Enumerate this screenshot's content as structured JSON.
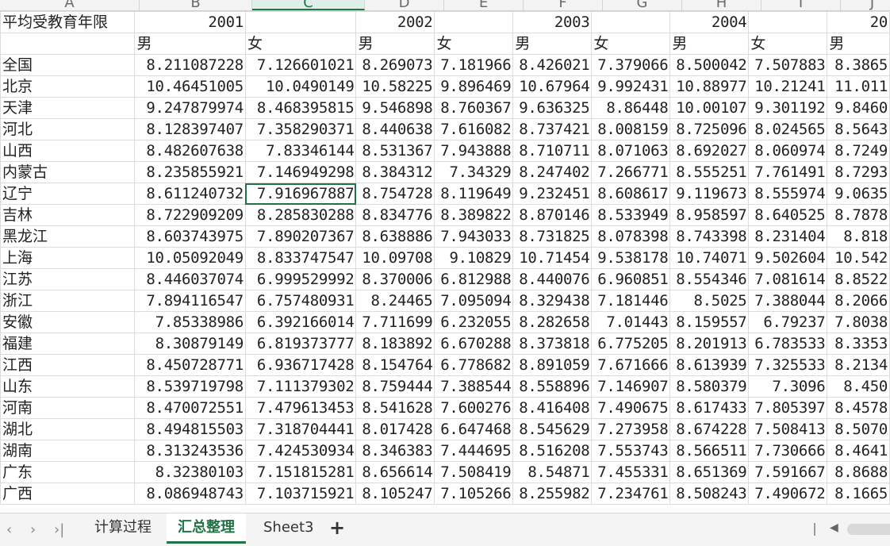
{
  "columns": [
    "A",
    "B",
    "C",
    "D",
    "E",
    "F",
    "G",
    "H",
    "I",
    "J"
  ],
  "header_row1": [
    "平均受教育年限",
    "2001",
    "",
    "2002",
    "",
    "2003",
    "",
    "2004",
    "",
    "20"
  ],
  "header_row2": [
    "",
    "男",
    "女",
    "男",
    "女",
    "男",
    "女",
    "男",
    "女",
    "男"
  ],
  "rows": [
    [
      "全国",
      "8.211087228",
      "7.126601021",
      "8.269073",
      "7.181966",
      "8.426021",
      "7.379066",
      "8.500042",
      "7.507883",
      "8.3865"
    ],
    [
      "北京",
      "10.46451005",
      "10.0490149",
      "10.58225",
      "9.896469",
      "10.67964",
      "9.992431",
      "10.88977",
      "10.21241",
      "11.011"
    ],
    [
      "天津",
      "9.247879974",
      "8.468395815",
      "9.546898",
      "8.760367",
      "9.636325",
      "8.86448",
      "10.00107",
      "9.301192",
      "9.8460"
    ],
    [
      "河北",
      "8.128397407",
      "7.358290371",
      "8.440638",
      "7.616082",
      "8.737421",
      "8.008159",
      "8.725096",
      "8.024565",
      "8.5643"
    ],
    [
      "山西",
      "8.482607638",
      "7.83346144",
      "8.531367",
      "7.943888",
      "8.710711",
      "8.071063",
      "8.692027",
      "8.060974",
      "8.7249"
    ],
    [
      "内蒙古",
      "8.235855921",
      "7.146949298",
      "8.384312",
      "7.34329",
      "8.247402",
      "7.266771",
      "8.555251",
      "7.761491",
      "8.7293"
    ],
    [
      "辽宁",
      "8.611240732",
      "7.916967887",
      "8.754728",
      "8.119649",
      "9.232451",
      "8.608617",
      "9.119673",
      "8.555974",
      "9.0635"
    ],
    [
      "吉林",
      "8.722909209",
      "8.285830288",
      "8.834776",
      "8.389822",
      "8.870146",
      "8.533949",
      "8.958597",
      "8.640525",
      "8.7878"
    ],
    [
      "黑龙江",
      "8.603743975",
      "7.890207367",
      "8.638886",
      "7.943033",
      "8.731825",
      "8.078398",
      "8.743398",
      "8.231404",
      "8.818"
    ],
    [
      "上海",
      "10.05092049",
      "8.833747547",
      "10.09708",
      "9.10829",
      "10.71454",
      "9.538178",
      "10.74071",
      "9.502604",
      "10.542"
    ],
    [
      "江苏",
      "8.446037074",
      "6.999529992",
      "8.370006",
      "6.812988",
      "8.440076",
      "6.960851",
      "8.554346",
      "7.081614",
      "8.8522"
    ],
    [
      "浙江",
      "7.894116547",
      "6.757480931",
      "8.24465",
      "7.095094",
      "8.329438",
      "7.181446",
      "8.5025",
      "7.388044",
      "8.2066"
    ],
    [
      "安徽",
      "7.85338986",
      "6.392166014",
      "7.711699",
      "6.232055",
      "8.282658",
      "7.01443",
      "8.159557",
      "6.79237",
      "7.8038"
    ],
    [
      "福建",
      "8.30879149",
      "6.819373777",
      "8.183892",
      "6.670288",
      "8.373818",
      "6.775205",
      "8.201913",
      "6.783533",
      "8.3353"
    ],
    [
      "江西",
      "8.450728771",
      "6.936717428",
      "8.154764",
      "6.778682",
      "8.891059",
      "7.671666",
      "8.613939",
      "7.325533",
      "8.2134"
    ],
    [
      "山东",
      "8.539719798",
      "7.111379302",
      "8.759444",
      "7.388544",
      "8.558896",
      "7.146907",
      "8.580379",
      "7.3096",
      "8.450"
    ],
    [
      "河南",
      "8.470072551",
      "7.479613453",
      "8.541628",
      "7.600276",
      "8.416408",
      "7.490675",
      "8.617433",
      "7.805397",
      "8.4578"
    ],
    [
      "湖北",
      "8.494815503",
      "7.318704441",
      "8.017428",
      "6.647468",
      "8.545629",
      "7.273958",
      "8.674228",
      "7.508413",
      "8.5070"
    ],
    [
      "湖南",
      "8.313243536",
      "7.424530934",
      "8.346383",
      "7.444695",
      "8.516208",
      "7.553743",
      "8.566511",
      "7.730666",
      "8.4641"
    ],
    [
      "广东",
      "8.32380103",
      "7.151815281",
      "8.656614",
      "7.508419",
      "8.54871",
      "7.455331",
      "8.651369",
      "7.591667",
      "8.8688"
    ],
    [
      "广西",
      "8.086948743",
      "7.103715921",
      "8.105247",
      "7.105266",
      "8.255982",
      "7.234761",
      "8.508243",
      "7.490672",
      "8.1665"
    ]
  ],
  "active_cell": {
    "row": 6,
    "col": 2
  },
  "sheet_tabs": [
    "计算过程",
    "汇总整理",
    "Sheet3"
  ],
  "active_tab": 1,
  "add_sheet_label": "+",
  "nav": {
    "prev": "‹",
    "next": "›",
    "last": "›|"
  },
  "colors": {
    "accent": "#217346",
    "grid": "#dcdcdc"
  }
}
